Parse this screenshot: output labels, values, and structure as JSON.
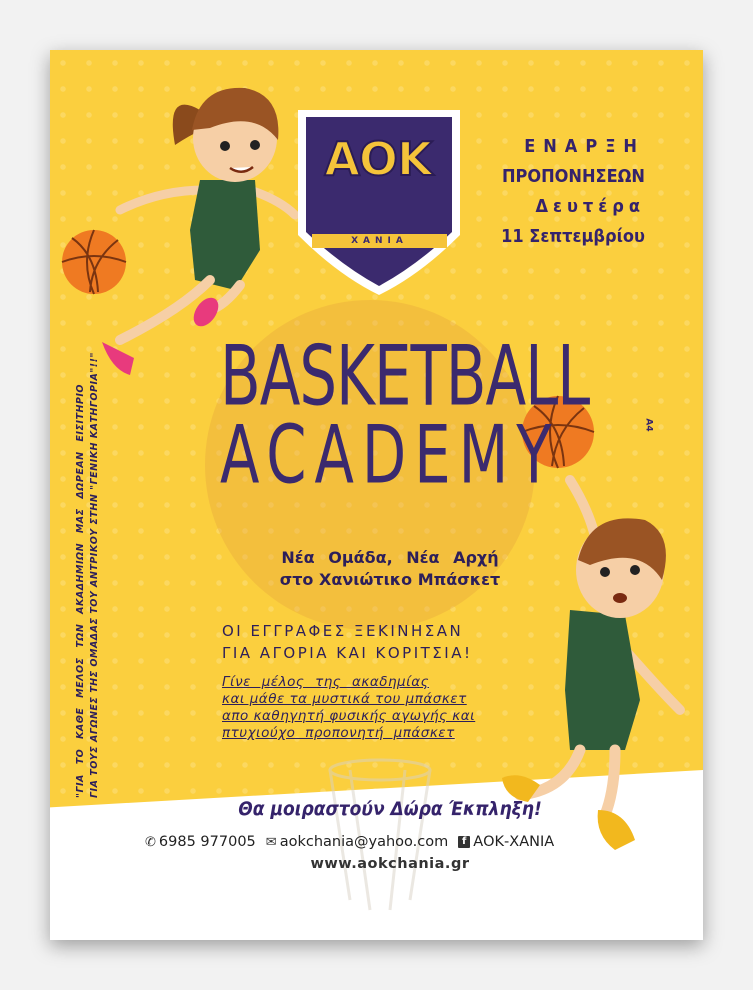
{
  "logo": {
    "letters": "ΑΟΚ",
    "ribbon": "ΧΑΝΙΑ"
  },
  "start": {
    "line1": "ΕΝΑΡΞΗ",
    "line2": "ΠΡΟΠΟΝΗΣΕΩΝ",
    "line3": "Δευτέρα",
    "line4": "11 Σεπτεμβρίου"
  },
  "title": {
    "line1": "BASKETBALL",
    "line2": "ACADEMY"
  },
  "subtitle": {
    "line1": "Νέα Ομάδα, Νέα Αρχή",
    "line2": "στο Χανιώτικο Μπάσκετ"
  },
  "registration": {
    "line1": "ΟΙ ΕΓΓΡΑΦΕΣ ΞΕΚΙΝΗΣΑΝ",
    "line2": "ΓΙΑ ΑΓΟΡΙΑ ΚΑΙ ΚΟΡΙΤΣΙΑ!"
  },
  "join": {
    "line1": "Γίνε μέλος της ακαδημίας",
    "line2": "και μάθε τα μυστικά του μπάσκετ",
    "line3": "απο καθηγητή φυσικής αγωγής και",
    "line4": "πτυχιούχο προπονητή μπάσκετ"
  },
  "vertical_note": {
    "line1": "\"ΓΙΑ ΤΟ ΚΑΘΕ ΜΕΛΟΣ ΤΩΝ ΑΚΑΔΗΜΙΩΝ ΜΑΣ ΔΩΡΕΑΝ ΕΙΣΙΤΗΡΙΟ",
    "line2": "ΓΙΑ ΤΟΥΣ ΑΓΩΝΕΣ ΤΗΣ ΟΜΑΔΑΣ ΤΟΥ ΑΝΤΡΙΚΟΥ ΣΤΗΝ \"ΓΕΝΙΚΗ ΚΑΤΗΓΟΡΙΑ\"!!\""
  },
  "gifts": "Θα μοιραστούν Δώρα Έκπληξη!",
  "contact": {
    "phone": "6985 977005",
    "email": "aokchania@yahoo.com",
    "facebook": "ΑΟΚ-ΧΑΝΙΑ",
    "website": "www.aokchania.gr"
  },
  "badge": "A4",
  "colors": {
    "background": "#fbcf3e",
    "purple": "#35236b",
    "jersey": "#2f5b3a",
    "ball": "#ef7a22"
  },
  "icons": [
    "phone-icon",
    "mail-icon",
    "facebook-icon",
    "basketball-icon",
    "shield-logo-icon"
  ]
}
